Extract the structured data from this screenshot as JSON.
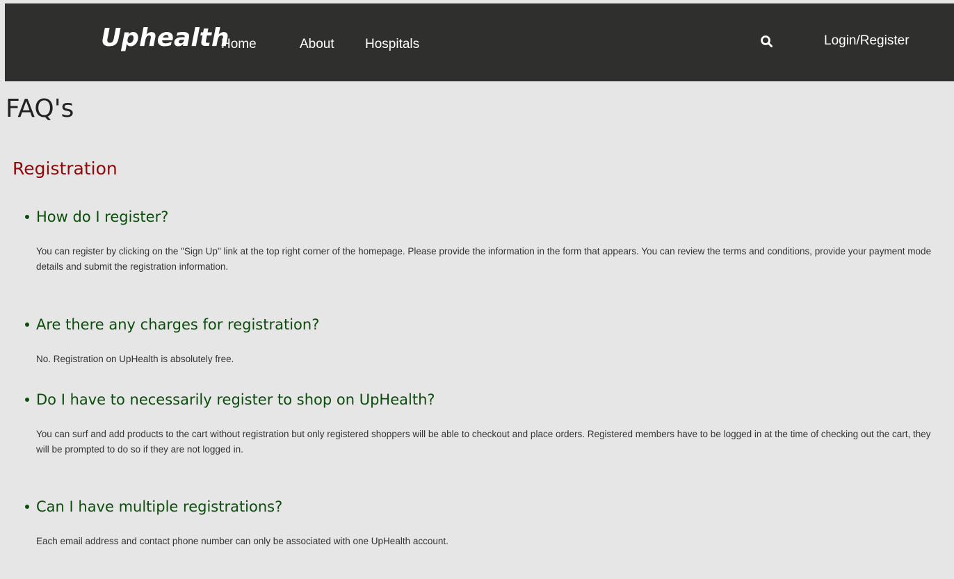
{
  "nav": {
    "brand": "Uphealth",
    "links": [
      "Home",
      "About",
      "Hospitals"
    ],
    "search_icon": "search-icon",
    "login": "Login/Register"
  },
  "page": {
    "title": "FAQ's",
    "section": "Registration"
  },
  "faqs": [
    {
      "question": "How do I register?",
      "answer": "You can register by clicking on the \"Sign Up\" link at the top right corner of the homepage. Please provide the information in the form that appears. You can review the terms and conditions, provide your payment mode details and submit the registration information."
    },
    {
      "question": "Are there any charges for registration?",
      "answer": "No. Registration on UpHealth is absolutely free."
    },
    {
      "question": "Do I have to necessarily register to shop on UpHealth?",
      "answer": "You can surf and add products to the cart without registration but only registered shoppers will be able to checkout and place orders. Registered members have to be logged in at the time of checking out the cart, they will be prompted to do so if they are not logged in."
    },
    {
      "question": "Can I have multiple registrations?",
      "answer": "Each email address and contact phone number can only be associated with one UpHealth account."
    }
  ]
}
